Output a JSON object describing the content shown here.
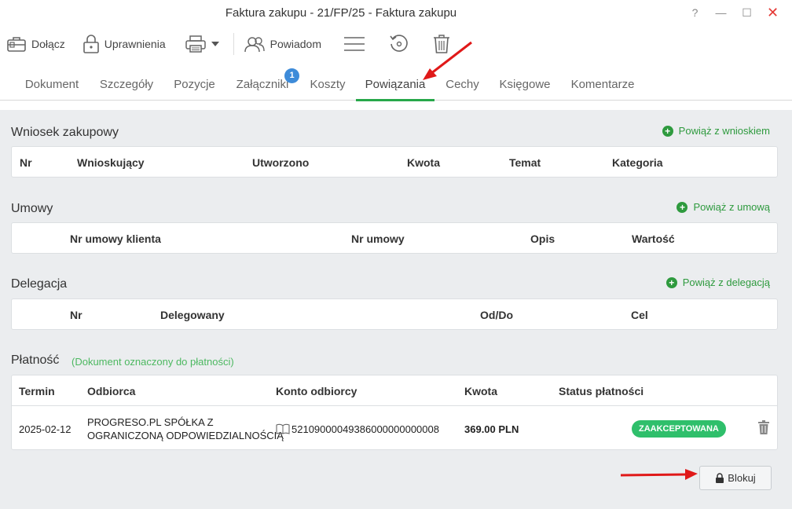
{
  "window": {
    "title": "Faktura zakupu - 21/FP/25 - Faktura zakupu",
    "help": "?",
    "minimize": "—",
    "maximize": "☐",
    "close": "✕"
  },
  "toolbar": {
    "attach": "Dołącz",
    "permissions": "Uprawnienia",
    "notify": "Powiadom"
  },
  "tabs": [
    {
      "label": "Dokument"
    },
    {
      "label": "Szczegóły"
    },
    {
      "label": "Pozycje"
    },
    {
      "label": "Załączniki",
      "badge": "1"
    },
    {
      "label": "Koszty"
    },
    {
      "label": "Powiązania"
    },
    {
      "label": "Cechy"
    },
    {
      "label": "Księgowe"
    },
    {
      "label": "Komentarze"
    }
  ],
  "active_tab": "Powiązania",
  "accent_color": "#27a84a",
  "purchase_request": {
    "title": "Wniosek zakupowy",
    "link": "Powiąż z wnioskiem",
    "columns": [
      "Nr",
      "Wnioskujący",
      "Utworzono",
      "Kwota",
      "Temat",
      "Kategoria"
    ]
  },
  "contracts": {
    "title": "Umowy",
    "link": "Powiąż z umową",
    "columns": [
      "Nr umowy klienta",
      "Nr umowy",
      "Opis",
      "Wartość"
    ]
  },
  "delegation": {
    "title": "Delegacja",
    "link": "Powiąż z delegacją",
    "columns": [
      "Nr",
      "Delegowany",
      "Od/Do",
      "Cel"
    ]
  },
  "payment": {
    "title": "Płatność",
    "note": "(Dokument oznaczony do płatności)",
    "columns": [
      "Termin",
      "Odbiorca",
      "Konto odbiorcy",
      "Kwota",
      "Status płatności"
    ],
    "row": {
      "due": "2025-02-12",
      "recipient_line1": "PROGRESO.PL SPÓŁKA Z",
      "recipient_line2": "OGRANICZONĄ ODPOWIEDZIALNOŚCIĄ",
      "account": "52109000049386000000000008",
      "amount": "369.00 PLN",
      "status": "ZAAKCEPTOWANA"
    },
    "block_button": "Blokuj"
  }
}
